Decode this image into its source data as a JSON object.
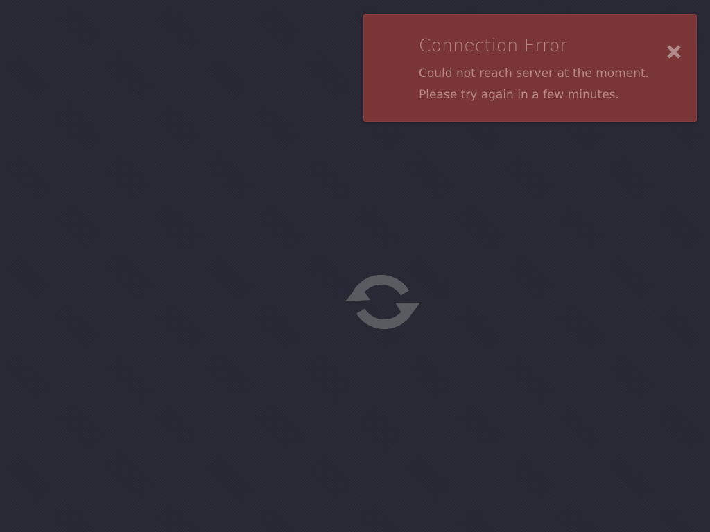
{
  "notification": {
    "type": "error",
    "title": "Connection Error",
    "message_line_1": "Could not reach server at the moment.",
    "message_line_2": "Please try again in a few minutes.",
    "close_icon": "close-icon",
    "background_color": "#7a3637",
    "text_color": "#b88886"
  },
  "loader": {
    "icon": "refresh-icon",
    "color": "#5a5b60"
  },
  "page": {
    "background_color": "#272834"
  }
}
